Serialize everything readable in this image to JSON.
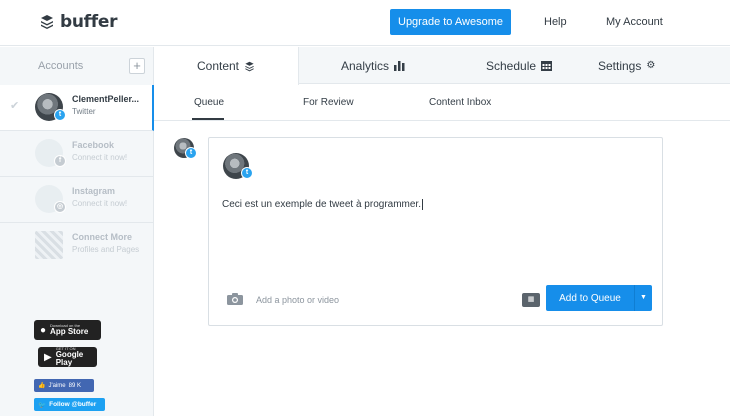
{
  "header": {
    "logo_text": "buffer",
    "upgrade_label": "Upgrade to Awesome",
    "help_label": "Help",
    "account_label": "My Account"
  },
  "sidebar": {
    "title": "Accounts",
    "add_glyph": "+",
    "accounts": [
      {
        "name": "ClementPeller...",
        "sub": "Twitter",
        "network": "twitter",
        "active": true
      },
      {
        "name": "Facebook",
        "sub": "Connect it now!",
        "network": "facebook",
        "active": false
      },
      {
        "name": "Instagram",
        "sub": "Connect it now!",
        "network": "instagram",
        "active": false
      },
      {
        "name": "Connect More",
        "sub": "Profiles and Pages",
        "network": "more",
        "active": false
      }
    ],
    "appstore": {
      "small": "Download on the",
      "big": "App Store"
    },
    "googleplay": {
      "small": "GET IT ON",
      "big": "Google Play"
    },
    "fb_like": {
      "label": "J'aime",
      "count": "89 K"
    },
    "tw_follow": {
      "label": "Follow @buffer"
    }
  },
  "main_tabs": [
    {
      "label": "Content",
      "icon": "stack-icon",
      "active": true
    },
    {
      "label": "Analytics",
      "icon": "bar-chart-icon",
      "active": false
    },
    {
      "label": "Schedule",
      "icon": "calendar-icon",
      "active": false
    },
    {
      "label": "Settings",
      "icon": "gear-icon",
      "active": false
    }
  ],
  "sub_tabs": [
    {
      "label": "Queue",
      "active": true
    },
    {
      "label": "For Review",
      "active": false
    },
    {
      "label": "Content Inbox",
      "active": false
    }
  ],
  "composer": {
    "text": "Ceci est un exemple de tweet à programmer.",
    "photo_label": "Add a photo or video",
    "add_to_queue_label": "Add to Queue"
  },
  "colors": {
    "accent": "#168eea",
    "twitter": "#2aa3ef",
    "sidebar_bg": "#f4f7f9"
  }
}
